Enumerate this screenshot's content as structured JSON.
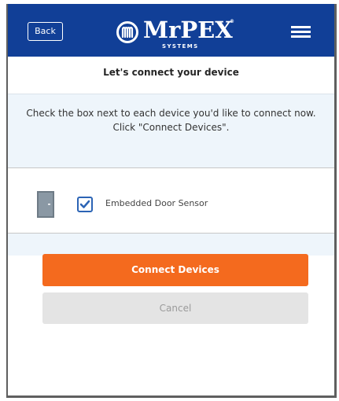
{
  "header": {
    "back_label": "Back",
    "logo_text": "MrPEX",
    "logo_subtext": "SYSTEMS"
  },
  "page": {
    "title": "Let's connect your device",
    "instructions": [
      "Check the box next to each device you'd like to connect now.",
      "Click \"Connect Devices\"."
    ]
  },
  "device": {
    "label": "Embedded Door Sensor",
    "checked": true
  },
  "actions": {
    "connect_label": "Connect Devices",
    "cancel_label": "Cancel"
  },
  "colors": {
    "header_blue": "#113f97",
    "action_orange": "#f46a1e",
    "cancel_gray": "#e4e4e4",
    "info_band": "#eef5fb"
  },
  "icons": {
    "logo": "mrpex-logo-icon",
    "menu": "hamburger-menu-icon",
    "door": "door-icon",
    "checkbox": "checkbox-checked-icon"
  }
}
